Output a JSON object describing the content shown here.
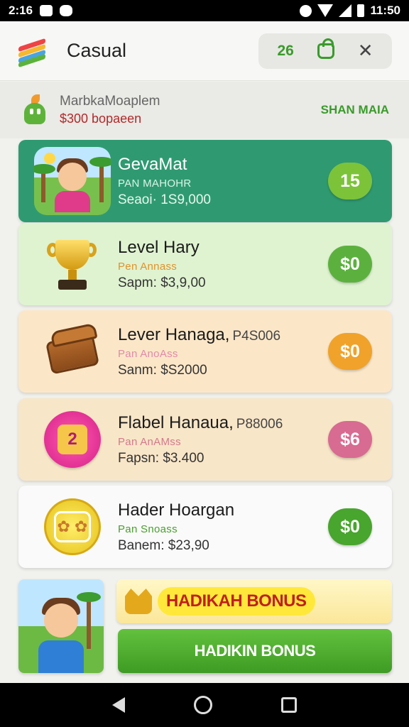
{
  "status_bar": {
    "time_left": "2:16",
    "time_right": "11:50"
  },
  "header": {
    "title": "Casual",
    "count": "26"
  },
  "promo": {
    "title": "MarbkaMoaplem",
    "subtitle": "$300 bopaeen",
    "link": "SHAN MAIA"
  },
  "items": [
    {
      "title": "GevaMat",
      "code": "",
      "subtitle": "PAN MAHOHR",
      "price_line": "Seaoi· 1S9,000",
      "badge": "15",
      "bg": "#2f9a72",
      "title_color": "#ffffff",
      "sub_color": "#d8f5e6",
      "badge_color": "#7cc33a"
    },
    {
      "title": "Level Hary",
      "code": "",
      "subtitle": "Pen Annass",
      "price_line": "Sapm: $3,9,00",
      "badge": "$0",
      "bg": "#dff3d1",
      "title_color": "#1b1b1b",
      "sub_color": "#e0922a",
      "badge_color": "#5cb13e"
    },
    {
      "title": "Lever Hanaga,",
      "code": "P4S006",
      "subtitle": "Pan AnoAss",
      "price_line": "Sanm: $S2000",
      "badge": "$0",
      "bg": "#fbe7c8",
      "title_color": "#1b1b1b",
      "sub_color": "#e08aa8",
      "badge_color": "#f0a22a"
    },
    {
      "title": "Flabel Hanaua,",
      "code": "P88006",
      "subtitle": "Pan AnAMss",
      "price_line": "Fapsn: $3.400",
      "badge": "$6",
      "bg": "#f8e6c8",
      "title_color": "#1b1b1b",
      "sub_color": "#d27a8b",
      "badge_color": "#d86b91"
    },
    {
      "title": "Hader Hoargan",
      "code": "",
      "subtitle": "Pan Snoass",
      "price_line": "Banem: $23,90",
      "badge": "$0",
      "bg": "#fafafa",
      "title_color": "#1b1b1b",
      "sub_color": "#4a9e2f",
      "badge_color": "#48a52d"
    }
  ],
  "bonus": {
    "banner": "HADIKAH BONUS",
    "button": "HADIKIN BONUS"
  }
}
